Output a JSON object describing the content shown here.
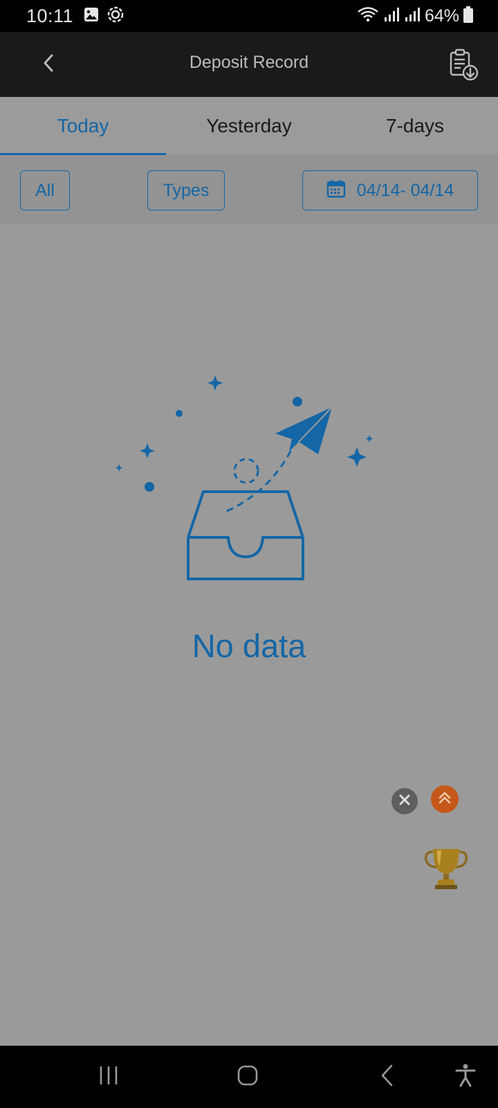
{
  "status_bar": {
    "time": "10:11",
    "battery": "64%",
    "icons": [
      "image-icon",
      "brightness-icon",
      "wifi-icon",
      "signal-icon",
      "signal-icon",
      "battery-icon"
    ]
  },
  "header": {
    "title": "Deposit Record",
    "back_icon": "chevron-left-icon",
    "action_icon": "clipboard-download-icon"
  },
  "tabs": [
    {
      "label": "Today",
      "active": true
    },
    {
      "label": "Yesterday",
      "active": false
    },
    {
      "label": "7-days",
      "active": false
    }
  ],
  "filters": {
    "all_label": "All",
    "types_label": "Types",
    "date_range": "04/14- 04/14",
    "date_icon": "calendar-icon"
  },
  "empty_state": {
    "message": "No data",
    "illustration": "empty-inbox-paper-plane"
  },
  "floating": {
    "close_icon": "close-icon",
    "scroll_up_icon": "double-chevron-up-icon",
    "promo_icon": "trophy-icon"
  },
  "colors": {
    "accent": "#1466a6",
    "overlay_background": "#9a9a9a",
    "header_background": "#1a1a1a",
    "scroll_up_button": "#c4581a"
  },
  "nav_bar": {
    "items": [
      "recent-apps-icon",
      "home-icon",
      "back-icon",
      "accessibility-icon"
    ]
  }
}
